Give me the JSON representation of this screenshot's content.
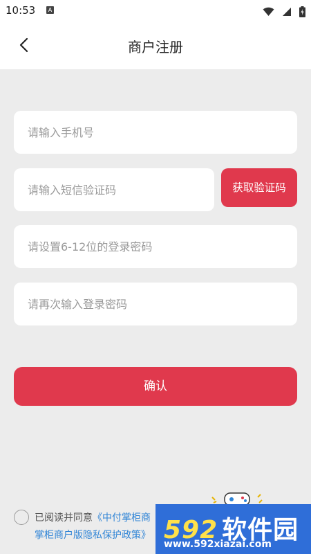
{
  "status_bar": {
    "time": "10:53",
    "notification_icon": "A"
  },
  "header": {
    "title": "商户注册"
  },
  "form": {
    "phone_placeholder": "请输入手机号",
    "code_placeholder": "请输入短信验证码",
    "get_code_label": "获取验证码",
    "password_placeholder": "请设置6-12位的登录密码",
    "confirm_password_placeholder": "请再次输入登录密码",
    "confirm_label": "确认"
  },
  "agreement": {
    "prefix": "已阅读并同意",
    "link1": "《中付掌柜商",
    "link2": "掌柜商户版隐私保护政策》"
  },
  "watermark": {
    "brand_num": "592",
    "brand_cn": "软件园",
    "url": "www.592xiazai.com"
  },
  "colors": {
    "accent": "#e0394d",
    "link": "#2f84d6",
    "background": "#ececec"
  }
}
